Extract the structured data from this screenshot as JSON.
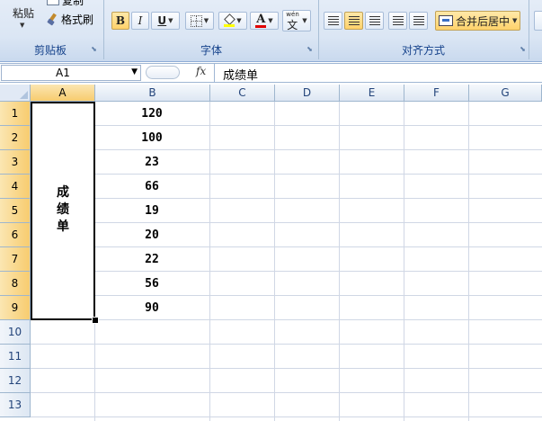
{
  "ribbon": {
    "clipboard": {
      "paste_label": "粘贴",
      "copy_label": "复制",
      "format_painter_label": "格式刷",
      "group_label": "剪贴板"
    },
    "font": {
      "bold": "B",
      "italic": "I",
      "underline": "U",
      "font_color_glyph": "A",
      "phonetic_glyph": "文",
      "phonetic_top": "wén",
      "group_label": "字体"
    },
    "alignment": {
      "merge_label": "合并后居中",
      "group_label": "对齐方式"
    }
  },
  "formula_bar": {
    "name_box": "A1",
    "fx": "fx",
    "content": "成绩单"
  },
  "sheet": {
    "columns": [
      "A",
      "B",
      "C",
      "D",
      "E",
      "F",
      "G"
    ],
    "rows": [
      "1",
      "2",
      "3",
      "4",
      "5",
      "6",
      "7",
      "8",
      "9",
      "10",
      "11",
      "12",
      "13"
    ],
    "merged_a1_a9": "成\n绩\n单",
    "col_b_values": [
      "120",
      "100",
      "23",
      "66",
      "19",
      "20",
      "22",
      "56",
      "90"
    ]
  },
  "colors": {
    "ribbon_bg": "#dbe6f4",
    "selected_header": "#f7cc6f",
    "grid_line": "#d0d7e5",
    "group_label": "#15428b"
  }
}
